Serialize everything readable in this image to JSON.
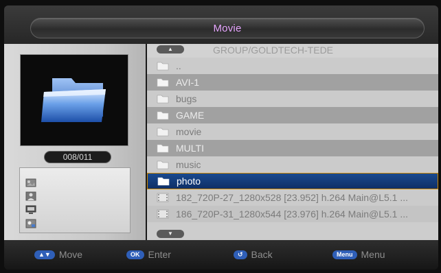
{
  "header": {
    "title": "Movie"
  },
  "preview": {
    "counter": "008/011"
  },
  "file_list": {
    "path": "GROUP/GOLDTECH-TEDE",
    "scroll_up_icon": "triangle-up",
    "scroll_down_icon": "triangle-down",
    "rows": [
      {
        "label": "..",
        "icon": "folder-icon"
      },
      {
        "label": "AVI-1",
        "icon": "folder-icon"
      },
      {
        "label": "bugs",
        "icon": "folder-icon"
      },
      {
        "label": "GAME",
        "icon": "folder-icon"
      },
      {
        "label": "movie",
        "icon": "folder-icon"
      },
      {
        "label": "MULTI",
        "icon": "folder-icon"
      },
      {
        "label": "music",
        "icon": "folder-icon"
      },
      {
        "label": "photo",
        "icon": "folder-icon",
        "selected": true
      },
      {
        "label": "182_720P-27_1280x528 [23.952] h.264 Main@L5.1 ...",
        "icon": "film-icon"
      },
      {
        "label": "186_720P-31_1280x544 [23.976] h.264 Main@L5.1 ...",
        "icon": "film-icon"
      }
    ]
  },
  "hints": [
    {
      "key": "▲▼",
      "label": "Move"
    },
    {
      "key": "OK",
      "label": "Enter"
    },
    {
      "key": "↺",
      "label": "Back"
    },
    {
      "key": "Menu",
      "label": "Menu"
    }
  ],
  "colors": {
    "title_text": "#e7a6ff",
    "selection_fill": "#1a4a8e",
    "selection_border": "#d08a00",
    "key_badge": "#2f5fb8"
  }
}
